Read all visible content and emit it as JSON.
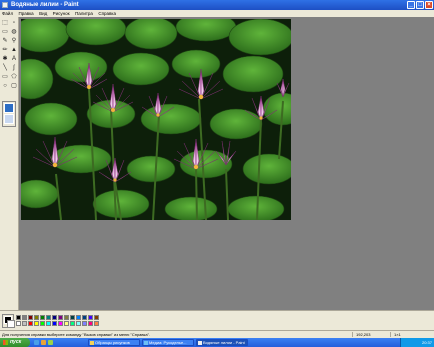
{
  "window": {
    "title": "Водяные лилии - Paint",
    "minimize_glyph": "_",
    "maximize_glyph": "□",
    "close_glyph": "×"
  },
  "menu": [
    "Файл",
    "Правка",
    "Вид",
    "Рисунок",
    "Палитра",
    "Справка"
  ],
  "tools": [
    {
      "name": "free-select-icon",
      "glyph": "⬚"
    },
    {
      "name": "rect-select-icon",
      "glyph": "▫"
    },
    {
      "name": "eraser-icon",
      "glyph": "▭"
    },
    {
      "name": "fill-icon",
      "glyph": "◍"
    },
    {
      "name": "color-picker-icon",
      "glyph": "✎"
    },
    {
      "name": "magnifier-icon",
      "glyph": "⚲"
    },
    {
      "name": "pencil-icon",
      "glyph": "✏"
    },
    {
      "name": "brush-icon",
      "glyph": "▲"
    },
    {
      "name": "airbrush-icon",
      "glyph": "✱"
    },
    {
      "name": "text-icon",
      "glyph": "A"
    },
    {
      "name": "line-icon",
      "glyph": "╲"
    },
    {
      "name": "curve-icon",
      "glyph": "∫"
    },
    {
      "name": "rectangle-icon",
      "glyph": "▭"
    },
    {
      "name": "polygon-icon",
      "glyph": "⬠"
    },
    {
      "name": "ellipse-icon",
      "glyph": "○"
    },
    {
      "name": "rounded-rect-icon",
      "glyph": "▢"
    }
  ],
  "palette": {
    "foreground": "#000000",
    "background": "#ffffff",
    "colors": [
      "#000000",
      "#808080",
      "#800000",
      "#808000",
      "#008000",
      "#008080",
      "#000080",
      "#800080",
      "#808040",
      "#004040",
      "#0080ff",
      "#004080",
      "#4000ff",
      "#804000",
      "#ffffff",
      "#c0c0c0",
      "#ff0000",
      "#ffff00",
      "#00ff00",
      "#00ffff",
      "#0000ff",
      "#ff00ff",
      "#ffff80",
      "#00ff80",
      "#80ffff",
      "#8080ff",
      "#ff0080",
      "#ff8040"
    ]
  },
  "status": {
    "hint": "Для получения справки выберите команду \"Вызов справки\" из меню \"Справка\".",
    "coords": "192,203",
    "size": "1×1"
  },
  "taskbar": {
    "start_label": "пуск",
    "tasks": [
      {
        "label": "Образцы рисунков",
        "active": false
      },
      {
        "label": "Медиа: Рукоделье...",
        "active": false
      },
      {
        "label": "Водяные лилии - Paint",
        "active": true
      }
    ],
    "clock": "20:37"
  }
}
